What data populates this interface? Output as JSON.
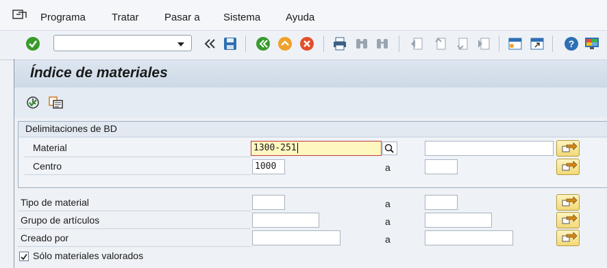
{
  "menubar": {
    "items": [
      "Programa",
      "Tratar",
      "Pasar a",
      "Sistema",
      "Ayuda"
    ]
  },
  "toolbar": {
    "command_field_value": ""
  },
  "page": {
    "title": "Índice de materiales"
  },
  "selection": {
    "group_title": "Delimitaciones de BD",
    "rows": [
      {
        "label": "Material",
        "from": "1300-251",
        "to": ""
      },
      {
        "label": "Centro",
        "from": "1000",
        "to": "",
        "to_label": "a"
      }
    ],
    "extra_rows": [
      {
        "label": "Tipo de material",
        "from": "",
        "to_label": "a",
        "to": ""
      },
      {
        "label": "Grupo de artículos",
        "from": "",
        "to_label": "a",
        "to": ""
      },
      {
        "label": "Creado por",
        "from": "",
        "to_label": "a",
        "to": ""
      }
    ],
    "checkbox": {
      "label": "Sólo materiales valorados",
      "checked": true
    }
  },
  "icons": {
    "menu": "menu-icon",
    "toolbar": [
      "enter-icon",
      "back-double-arrow-icon",
      "save-icon",
      "back-icon",
      "exit-icon",
      "cancel-icon",
      "print-icon",
      "find-icon",
      "find-next-icon",
      "first-page-icon",
      "previous-page-icon",
      "next-page-icon",
      "last-page-icon",
      "new-session-icon",
      "shortcut-icon",
      "help-icon",
      "customize-layout-icon"
    ]
  },
  "colors": {
    "focus_field_bg": "#fff7c0",
    "multiple_selection_btn": "#f2d978",
    "enter_green": "#3a9a2a"
  }
}
